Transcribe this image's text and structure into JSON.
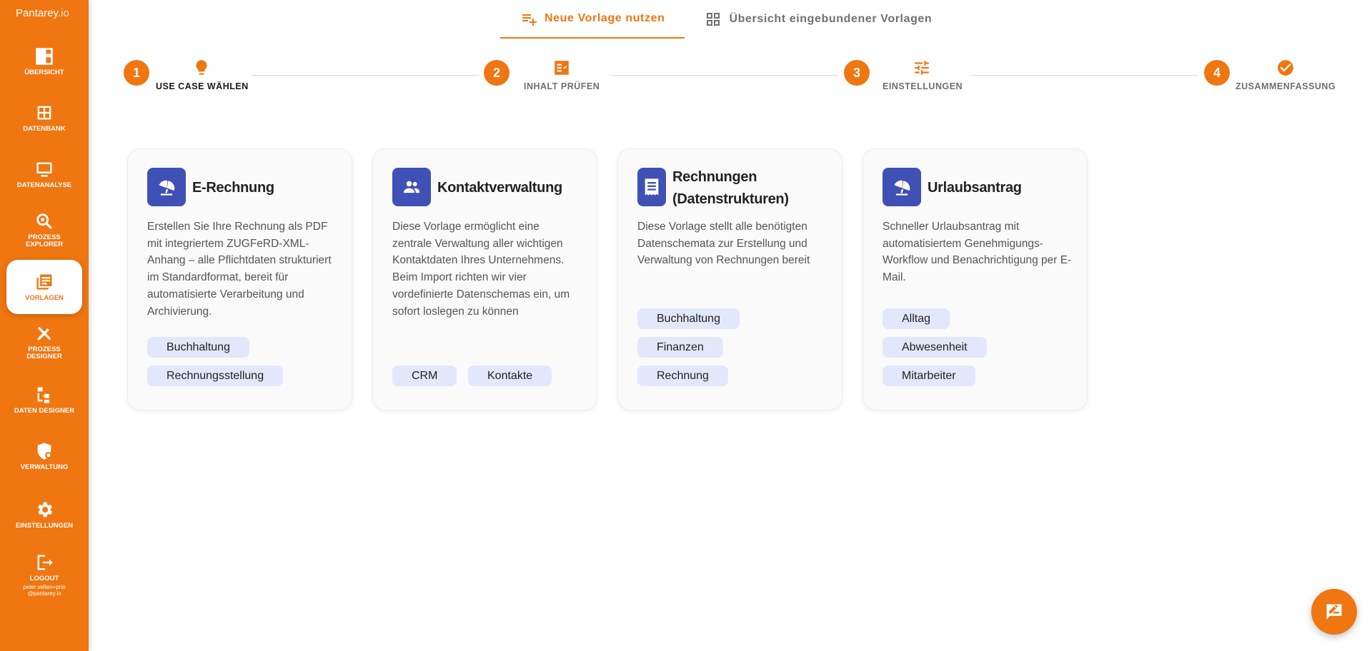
{
  "brand": {
    "name_a": "Pantarey",
    "name_b": ".io"
  },
  "sidebar": {
    "items": [
      {
        "label": "ÜBERSICHT",
        "icon": "dashboard-icon"
      },
      {
        "label": "DATENBANK",
        "icon": "grid-icon"
      },
      {
        "label": "DATENANALYSE",
        "icon": "monitor-icon"
      },
      {
        "label": "PROZESS\nEXPLORER",
        "icon": "search-process-icon"
      },
      {
        "label": "VORLAGEN",
        "icon": "templates-icon",
        "active": true
      },
      {
        "label": "PROZESS\nDESIGNER",
        "icon": "design-tools-icon"
      },
      {
        "label": "DATEN DESIGNER",
        "icon": "hierarchy-icon"
      },
      {
        "label": "VERWALTUNG",
        "icon": "admin-shield-icon"
      },
      {
        "label": "EINSTELLUNGEN",
        "icon": "gear-icon"
      },
      {
        "label": "LOGOUT",
        "icon": "logout-icon"
      }
    ],
    "user_email": "peter.velten+prio\n@pantarey.io"
  },
  "tabs": [
    {
      "label": "Neue Vorlage nutzen",
      "icon": "playlist-add-icon",
      "active": true
    },
    {
      "label": "Übersicht eingebundener Vorlagen",
      "icon": "grid-view-icon",
      "active": false
    }
  ],
  "stepper": [
    {
      "number": "1",
      "label": "USE CASE WÄHLEN",
      "icon": "lightbulb-icon",
      "active": true
    },
    {
      "number": "2",
      "label": "INHALT PRÜFEN",
      "icon": "checklist-icon",
      "active": false
    },
    {
      "number": "3",
      "label": "EINSTELLUNGEN",
      "icon": "tune-icon",
      "active": false
    },
    {
      "number": "4",
      "label": "ZUSAMMENFASSUNG",
      "icon": "check-circle-icon",
      "active": false
    }
  ],
  "cards": [
    {
      "title": "E-Rechnung",
      "icon": "beach-umbrella-icon",
      "description": "Erstellen Sie Ihre Rechnung als PDF mit integriertem ZUGFeRD-XML-Anhang – alle Pflichtdaten strukturiert im Standardformat, bereit für automatisierte Verarbeitung und Archivierung.",
      "tags": [
        "Buchhaltung",
        "Rechnungsstellung"
      ]
    },
    {
      "title": "Kontaktverwaltung",
      "icon": "people-icon",
      "description": "Diese Vorlage ermöglicht eine zentrale Verwaltung aller wichtigen Kontaktdaten Ihres Unternehmens. Beim Import richten wir vier vordefinierte Datenschemas ein, um sofort loslegen zu können",
      "tags": [
        "CRM",
        "Kontakte"
      ]
    },
    {
      "title": "Rechnungen (Datenstrukturen)",
      "icon": "receipt-icon",
      "description": "Diese Vorlage stellt alle benötigten Datenschemata zur Erstellung und Verwaltung von Rechnungen bereit",
      "tags": [
        "Buchhaltung",
        "Finanzen",
        "Rechnung"
      ]
    },
    {
      "title": "Urlaubsantrag",
      "icon": "beach-umbrella-icon",
      "description": "Schneller Urlaubsantrag mit automatisiertem Genehmigungs-Workflow und Benachrichtigung per E-Mail.",
      "tags": [
        "Alltag",
        "Abwesenheit",
        "Mitarbeiter"
      ]
    }
  ],
  "fab": {
    "icon": "feedback-chat-icon"
  },
  "colors": {
    "accent": "#ef7610",
    "card_icon_bg": "#3f51b5",
    "chip_bg": "#e3e7fb"
  }
}
